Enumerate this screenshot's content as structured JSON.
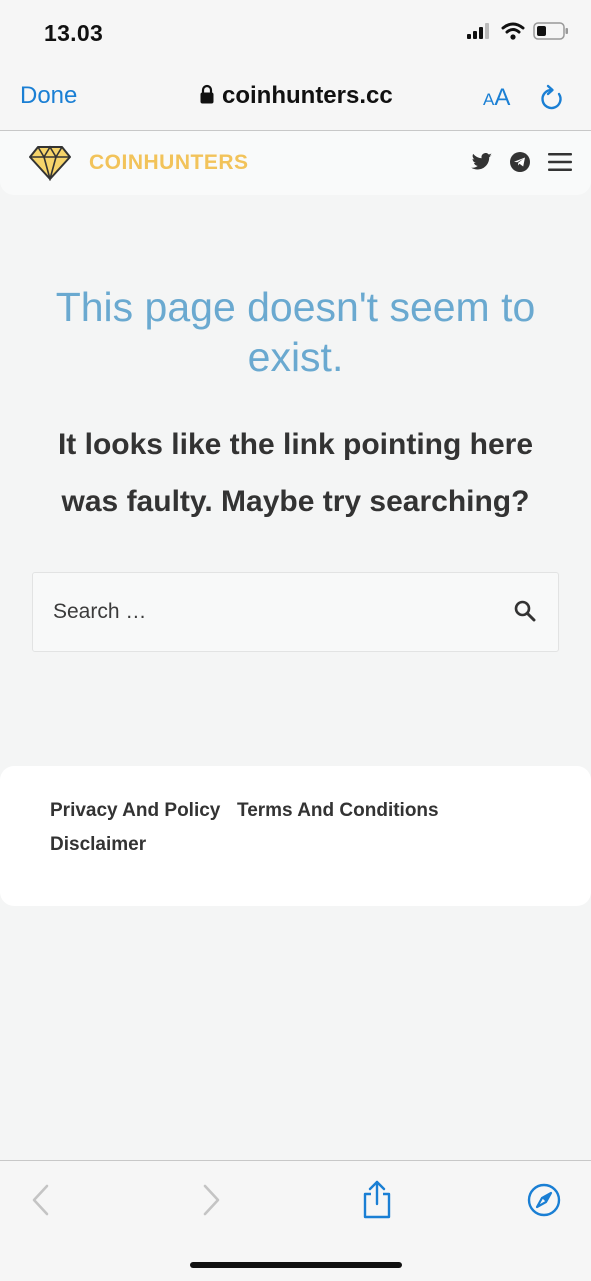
{
  "status_bar": {
    "time": "13.03",
    "icons": [
      "signal-icon",
      "wifi-icon",
      "battery-icon"
    ]
  },
  "browser": {
    "done_label": "Done",
    "url": "coinhunters.cc",
    "text_size_small": "A",
    "text_size_large": "A",
    "icons": [
      "lock-icon",
      "reload-icon"
    ]
  },
  "site_header": {
    "name": "COINHUNTERS",
    "brand_color": "#f2c35a",
    "icons": [
      "diamond-logo-icon",
      "twitter-icon",
      "telegram-icon",
      "hamburger-menu-icon"
    ]
  },
  "main": {
    "title": "This page doesn't seem to exist.",
    "subtitle": "It looks like the link pointing here was faulty. Maybe try searching?",
    "title_color": "#6aa9d0",
    "search": {
      "placeholder": "Search …",
      "value": "",
      "icon": "search-icon"
    }
  },
  "footer": {
    "links": [
      "Privacy And Policy",
      "Terms And Conditions",
      "Disclaimer"
    ]
  },
  "toolbar": {
    "icons": [
      "back-icon",
      "forward-icon",
      "share-icon",
      "compass-icon"
    ],
    "accent_color": "#1a7fd4"
  }
}
